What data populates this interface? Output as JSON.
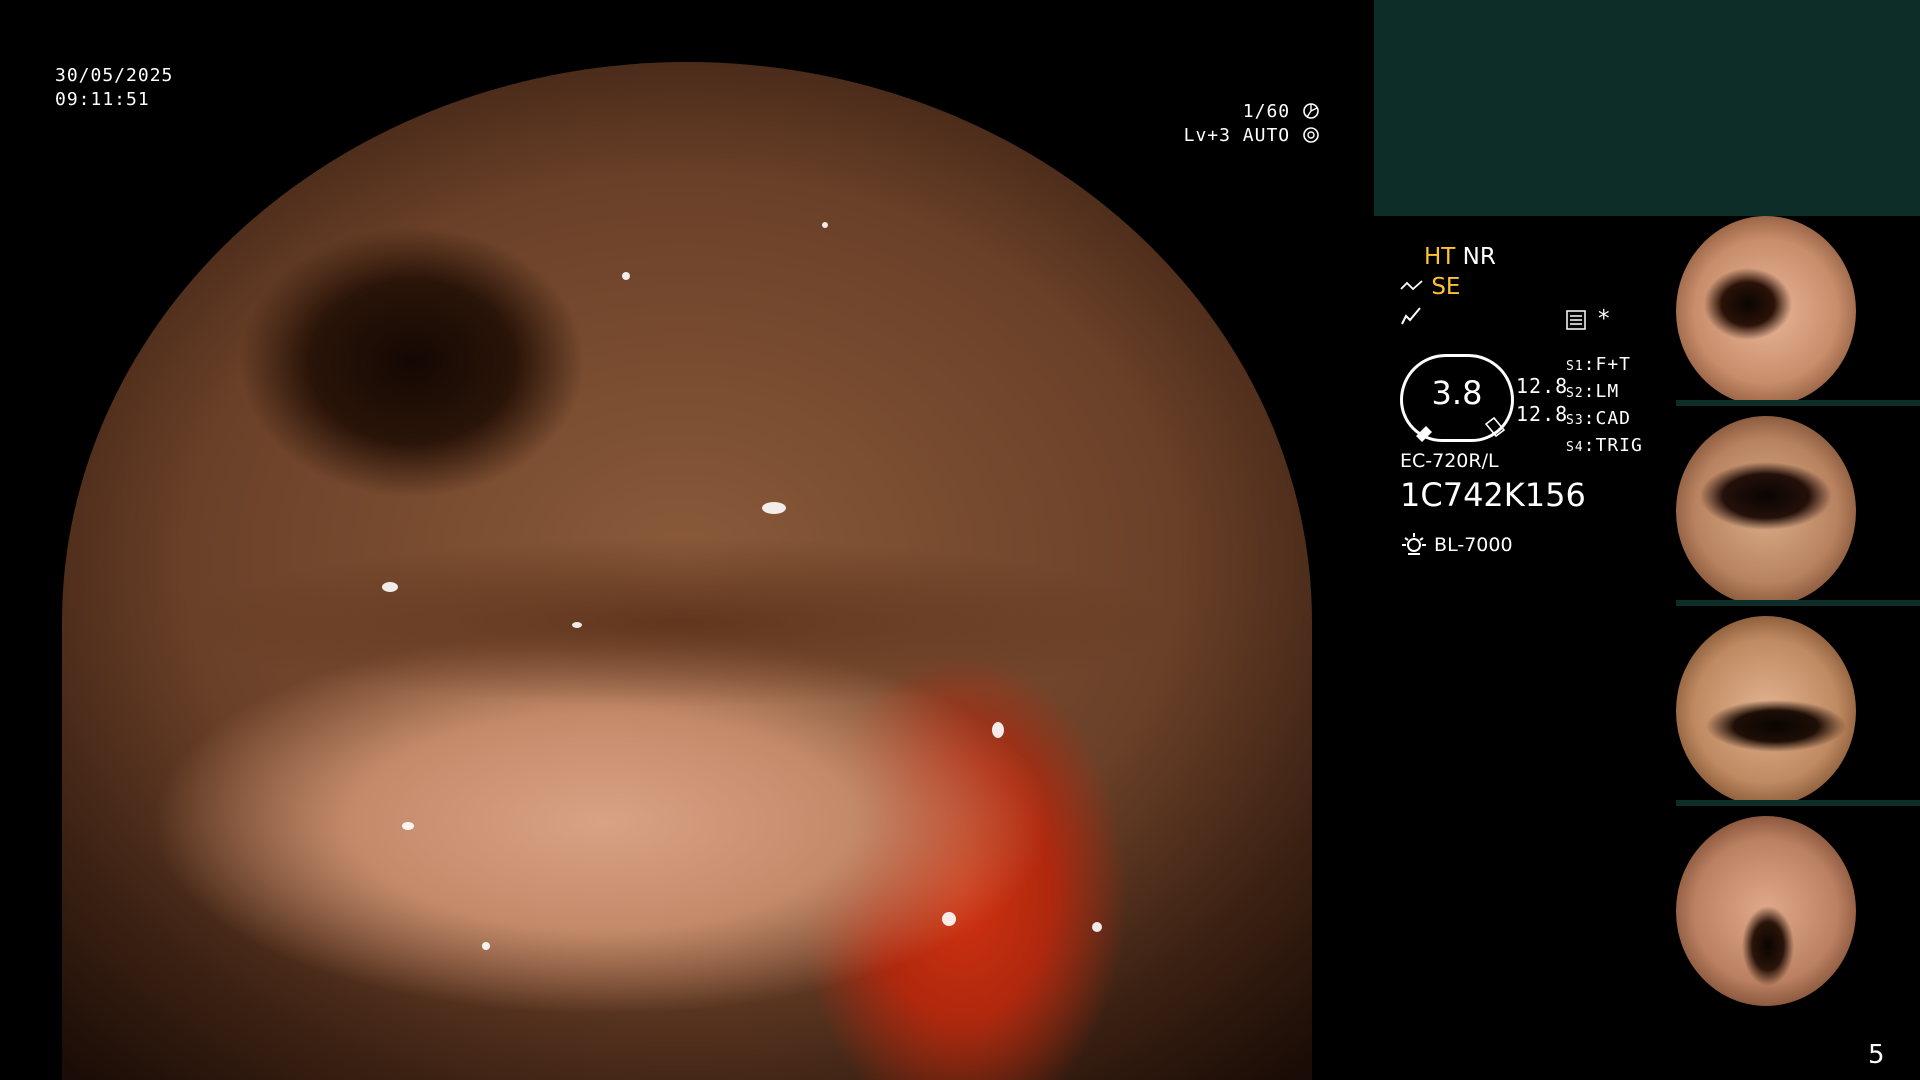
{
  "overlay": {
    "date": "30/05/2025",
    "time": "09:11:51",
    "shutter": "1/60",
    "level": "Lv+3 AUTO"
  },
  "status": {
    "ht": "HT",
    "nr": "NR",
    "se": "SE",
    "star": "*",
    "gauge_value": "3.8",
    "val1": "12.8",
    "val2": "12.8",
    "switches": [
      {
        "key": "S1",
        "val": "F+T"
      },
      {
        "key": "S2",
        "val": "LM"
      },
      {
        "key": "S3",
        "val": "CAD"
      },
      {
        "key": "S4",
        "val": "TRIG"
      }
    ],
    "scope_model": "EC-720R/L",
    "serial": "1C742K156",
    "light_source": "BL-7000"
  },
  "page_number": "5",
  "colors": {
    "panel_teal": "#0d2d29",
    "amber": "#ffc233",
    "background": "#000000"
  },
  "icons": [
    "shutter-wheel-icon",
    "iris-icon",
    "wave-icon",
    "sharpness-icon",
    "menu-icon",
    "lamp-icon"
  ]
}
